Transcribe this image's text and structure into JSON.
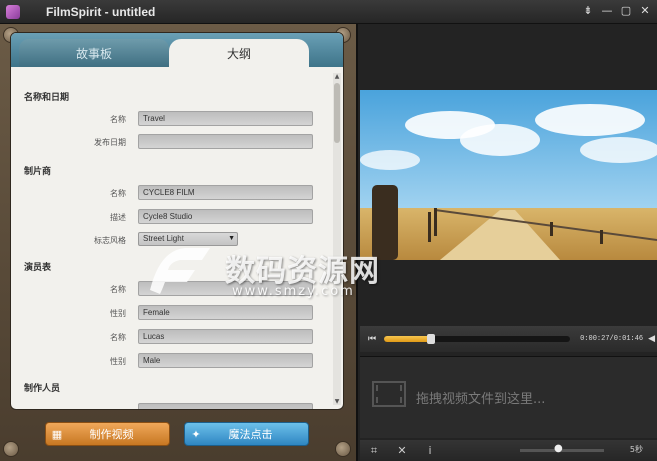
{
  "window": {
    "title": "FilmSpirit - untitled",
    "controls": [
      "⇟",
      "—",
      "▢",
      "✕"
    ]
  },
  "tabs": {
    "storyboard": "故事板",
    "outline": "大纲"
  },
  "form": {
    "section_name_date": "名称和日期",
    "name_label": "名称",
    "name_value": "Travel",
    "release_label": "发布日期",
    "release_value": "",
    "section_producer": "制片商",
    "producer_name_label": "名称",
    "producer_name_value": "CYCLE8 FILM",
    "producer_desc_label": "描述",
    "producer_desc_value": "Cycle8 Studio",
    "logo_style_label": "标志风格",
    "logo_style_value": "Street Light",
    "section_cast": "演员表",
    "cast1_name_label": "名称",
    "cast1_name_value": "",
    "cast1_gender_label": "性别",
    "cast1_gender_value": "Female",
    "cast2_name_label": "名称",
    "cast2_name_value": "Lucas",
    "cast2_gender_label": "性别",
    "cast2_gender_value": "Male",
    "section_crew": "制作人员"
  },
  "buttons": {
    "make_video": "制作视频",
    "magic_click": "魔法点击"
  },
  "player": {
    "timecode": "0:00:27/0:01:46",
    "progress": 0.25
  },
  "dropzone": {
    "text": "拖拽视频文件到这里..."
  },
  "toolbar": {
    "zoom_label": "5秒"
  },
  "watermark": {
    "main": "数码资源网",
    "sub": "www.smzy.com"
  },
  "colors": {
    "accent_orange": "#e09a17",
    "tab_blue": "#3e7489",
    "button_orange": "#c77722",
    "button_blue": "#2f86c2"
  }
}
